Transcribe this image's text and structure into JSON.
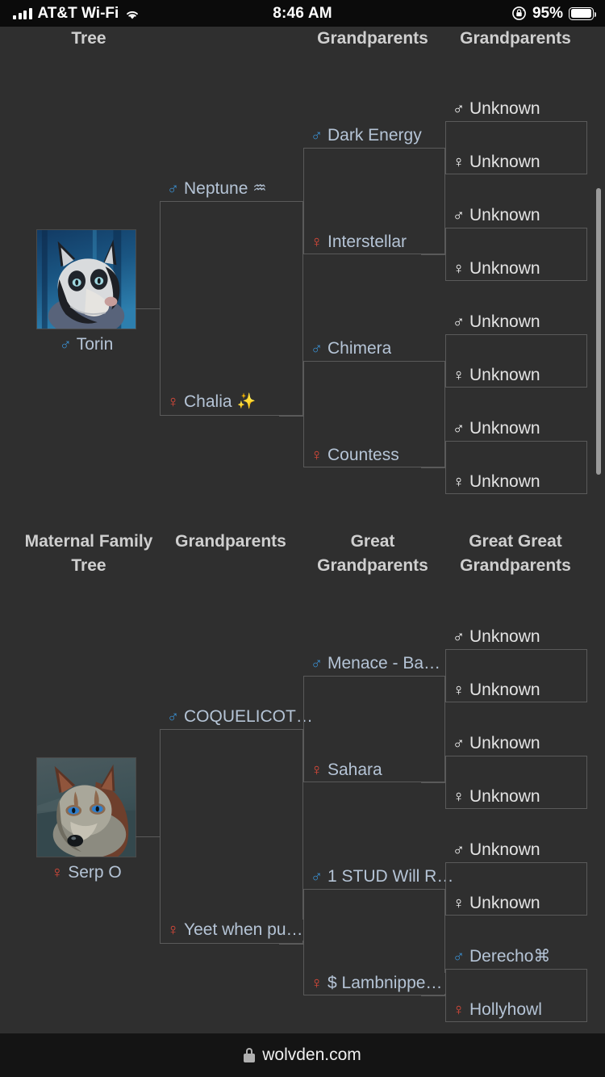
{
  "status_bar": {
    "carrier": "AT&T Wi-Fi",
    "time": "8:46 AM",
    "battery_percent": "95%",
    "signal_icon": "cellular-signal-icon",
    "wifi_icon": "wifi-icon",
    "rotation_lock_icon": "rotation-lock-icon",
    "battery_icon": "battery-icon"
  },
  "browser": {
    "domain": "wolvden.com",
    "lock_icon": "lock-icon"
  },
  "paternal": {
    "headers": [
      {
        "label": "Tree"
      },
      {
        "label": ""
      },
      {
        "label": "Grandparents"
      },
      {
        "label": "Grandparents"
      }
    ],
    "subject": {
      "name": "Torin",
      "sex": "male",
      "symbol": "♂",
      "portrait_alt": "black-and-white-wolf-blue-forest"
    },
    "gen1": [
      {
        "name": "Neptune",
        "sex": "male",
        "symbol": "♂",
        "emoji": "♒"
      },
      {
        "name": "Chalia",
        "sex": "female",
        "symbol": "♀",
        "emoji": "✨"
      }
    ],
    "gen2": [
      {
        "name": "Dark Energy",
        "sex": "male",
        "symbol": "♂"
      },
      {
        "name": "Interstellar",
        "sex": "female",
        "symbol": "♀"
      },
      {
        "name": "Chimera",
        "sex": "male",
        "symbol": "♂"
      },
      {
        "name": "Countess",
        "sex": "female",
        "symbol": "♀"
      }
    ],
    "gen3": [
      {
        "name": "Unknown",
        "sex": "unknown-male",
        "symbol": "♂"
      },
      {
        "name": "Unknown",
        "sex": "unknown-female",
        "symbol": "♀"
      },
      {
        "name": "Unknown",
        "sex": "unknown-male",
        "symbol": "♂"
      },
      {
        "name": "Unknown",
        "sex": "unknown-female",
        "symbol": "♀"
      },
      {
        "name": "Unknown",
        "sex": "unknown-male",
        "symbol": "♂"
      },
      {
        "name": "Unknown",
        "sex": "unknown-female",
        "symbol": "♀"
      },
      {
        "name": "Unknown",
        "sex": "unknown-male",
        "symbol": "♂"
      },
      {
        "name": "Unknown",
        "sex": "unknown-female",
        "symbol": "♀"
      }
    ]
  },
  "maternal": {
    "headers": [
      {
        "label": "Maternal Family Tree"
      },
      {
        "label": "Grandparents"
      },
      {
        "label": "Great Grandparents"
      },
      {
        "label": "Great Great Grandparents"
      }
    ],
    "subject": {
      "name": "Serp O",
      "sex": "female",
      "symbol": "♀",
      "portrait_alt": "brown-grey-wolf-blue-eyes"
    },
    "gen1": [
      {
        "name": "COQUELICOT…",
        "sex": "male",
        "symbol": "♂"
      },
      {
        "name": "Yeet when pu…",
        "sex": "female",
        "symbol": "♀"
      }
    ],
    "gen2": [
      {
        "name": "Menace - Ba…",
        "sex": "male",
        "symbol": "♂"
      },
      {
        "name": "Sahara",
        "sex": "female",
        "symbol": "♀"
      },
      {
        "name": "1 STUD Will R…",
        "sex": "male",
        "symbol": "♂"
      },
      {
        "name": "$ Lambnippe…",
        "sex": "female",
        "symbol": "♀"
      }
    ],
    "gen3": [
      {
        "name": "Unknown",
        "sex": "unknown-male",
        "symbol": "♂"
      },
      {
        "name": "Unknown",
        "sex": "unknown-female",
        "symbol": "♀"
      },
      {
        "name": "Unknown",
        "sex": "unknown-male",
        "symbol": "♂"
      },
      {
        "name": "Unknown",
        "sex": "unknown-female",
        "symbol": "♀"
      },
      {
        "name": "Unknown",
        "sex": "unknown-male",
        "symbol": "♂"
      },
      {
        "name": "Unknown",
        "sex": "unknown-female",
        "symbol": "♀"
      },
      {
        "name": "Derecho⌘",
        "sex": "male",
        "symbol": "♂"
      },
      {
        "name": "Hollyhowl",
        "sex": "female",
        "symbol": "♀"
      }
    ]
  },
  "colors": {
    "background": "#2f2f2f",
    "male": "#3a8fd0",
    "female": "#e04a3a",
    "name_text": "#b5c4d6",
    "header_text": "#cfcfcf",
    "border": "#5a5a5a"
  }
}
